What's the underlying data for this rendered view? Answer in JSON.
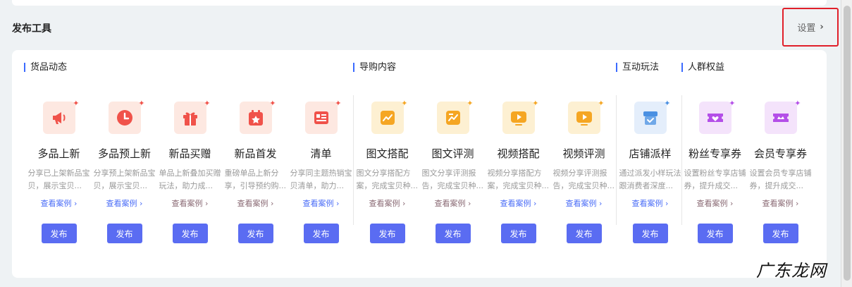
{
  "header": {
    "title": "发布工具",
    "settings_label": "设置",
    "settings_chevron": "›"
  },
  "groups": [
    {
      "title": "货品动态"
    },
    {
      "title": "导购内容"
    },
    {
      "title": "互动玩法"
    },
    {
      "title": "人群权益"
    }
  ],
  "tools": [
    {
      "name": "多品上新",
      "desc": "分享已上架新品宝贝，展示宝贝...",
      "link": "查看案例 ›",
      "button": "发布",
      "icon": "megaphone-icon",
      "color": "#f0524a",
      "bg": "#fde8e1"
    },
    {
      "name": "多品预上新",
      "desc": "分享预上架新品宝贝，展示宝贝...",
      "link": "查看案例 ›",
      "button": "发布",
      "icon": "clock-icon",
      "color": "#f0524a",
      "bg": "#fde8e1"
    },
    {
      "name": "新品买赠",
      "desc": "单品上新叠加买赠玩法，助力成...",
      "link": "查看案例 ›",
      "button": "发布",
      "icon": "gift-icon",
      "color": "#f0524a",
      "bg": "#fde8e1"
    },
    {
      "name": "新品首发",
      "desc": "重磅单品上新分享，引导预约购...",
      "link": "查看案例 ›",
      "button": "发布",
      "icon": "calendar-star-icon",
      "color": "#f0524a",
      "bg": "#fde8e1"
    },
    {
      "name": "清单",
      "desc": "分享同主题热销宝贝清单，助力...",
      "link": "查看案例 ›",
      "button": "发布",
      "icon": "list-icon",
      "color": "#f0524a",
      "bg": "#fde8e1"
    },
    {
      "name": "图文搭配",
      "desc": "图文分享搭配方案，完成宝贝种...",
      "link": "查看案例 ›",
      "button": "发布",
      "icon": "image-text-icon",
      "color": "#f5a623",
      "bg": "#fdf0d2"
    },
    {
      "name": "图文评测",
      "desc": "图文分享评测报告，完成宝贝种...",
      "link": "查看案例 ›",
      "button": "发布",
      "icon": "image-review-icon",
      "color": "#f5a623",
      "bg": "#fdf0d2"
    },
    {
      "name": "视频搭配",
      "desc": "视频分享搭配方案，完成宝贝种...",
      "link": "查看案例 ›",
      "button": "发布",
      "icon": "video-icon",
      "color": "#f5a623",
      "bg": "#fdf0d2"
    },
    {
      "name": "视频评测",
      "desc": "视频分享评测报告，完成宝贝种...",
      "link": "查看案例 ›",
      "button": "发布",
      "icon": "video-review-icon",
      "color": "#f5a623",
      "bg": "#fdf0d2"
    },
    {
      "name": "店铺派样",
      "desc": "通过派发小样玩法跟消费者深度...",
      "link": "查看案例 ›",
      "button": "发布",
      "icon": "sample-box-icon",
      "color": "#4a90e2",
      "bg": "#e4eefb"
    },
    {
      "name": "粉丝专享券",
      "desc": "设置粉丝专享店铺券，提升成交...",
      "link": "查看案例 ›",
      "button": "发布",
      "icon": "coupon-heart-icon",
      "color": "#b44fe8",
      "bg": "#f4e3fb"
    },
    {
      "name": "会员专享券",
      "desc": "设置会员专享店铺券，提升成交...",
      "link": "查看案例 ›",
      "button": "发布",
      "icon": "coupon-member-icon",
      "color": "#b44fe8",
      "bg": "#f4e3fb"
    }
  ],
  "watermark": "广东龙网"
}
